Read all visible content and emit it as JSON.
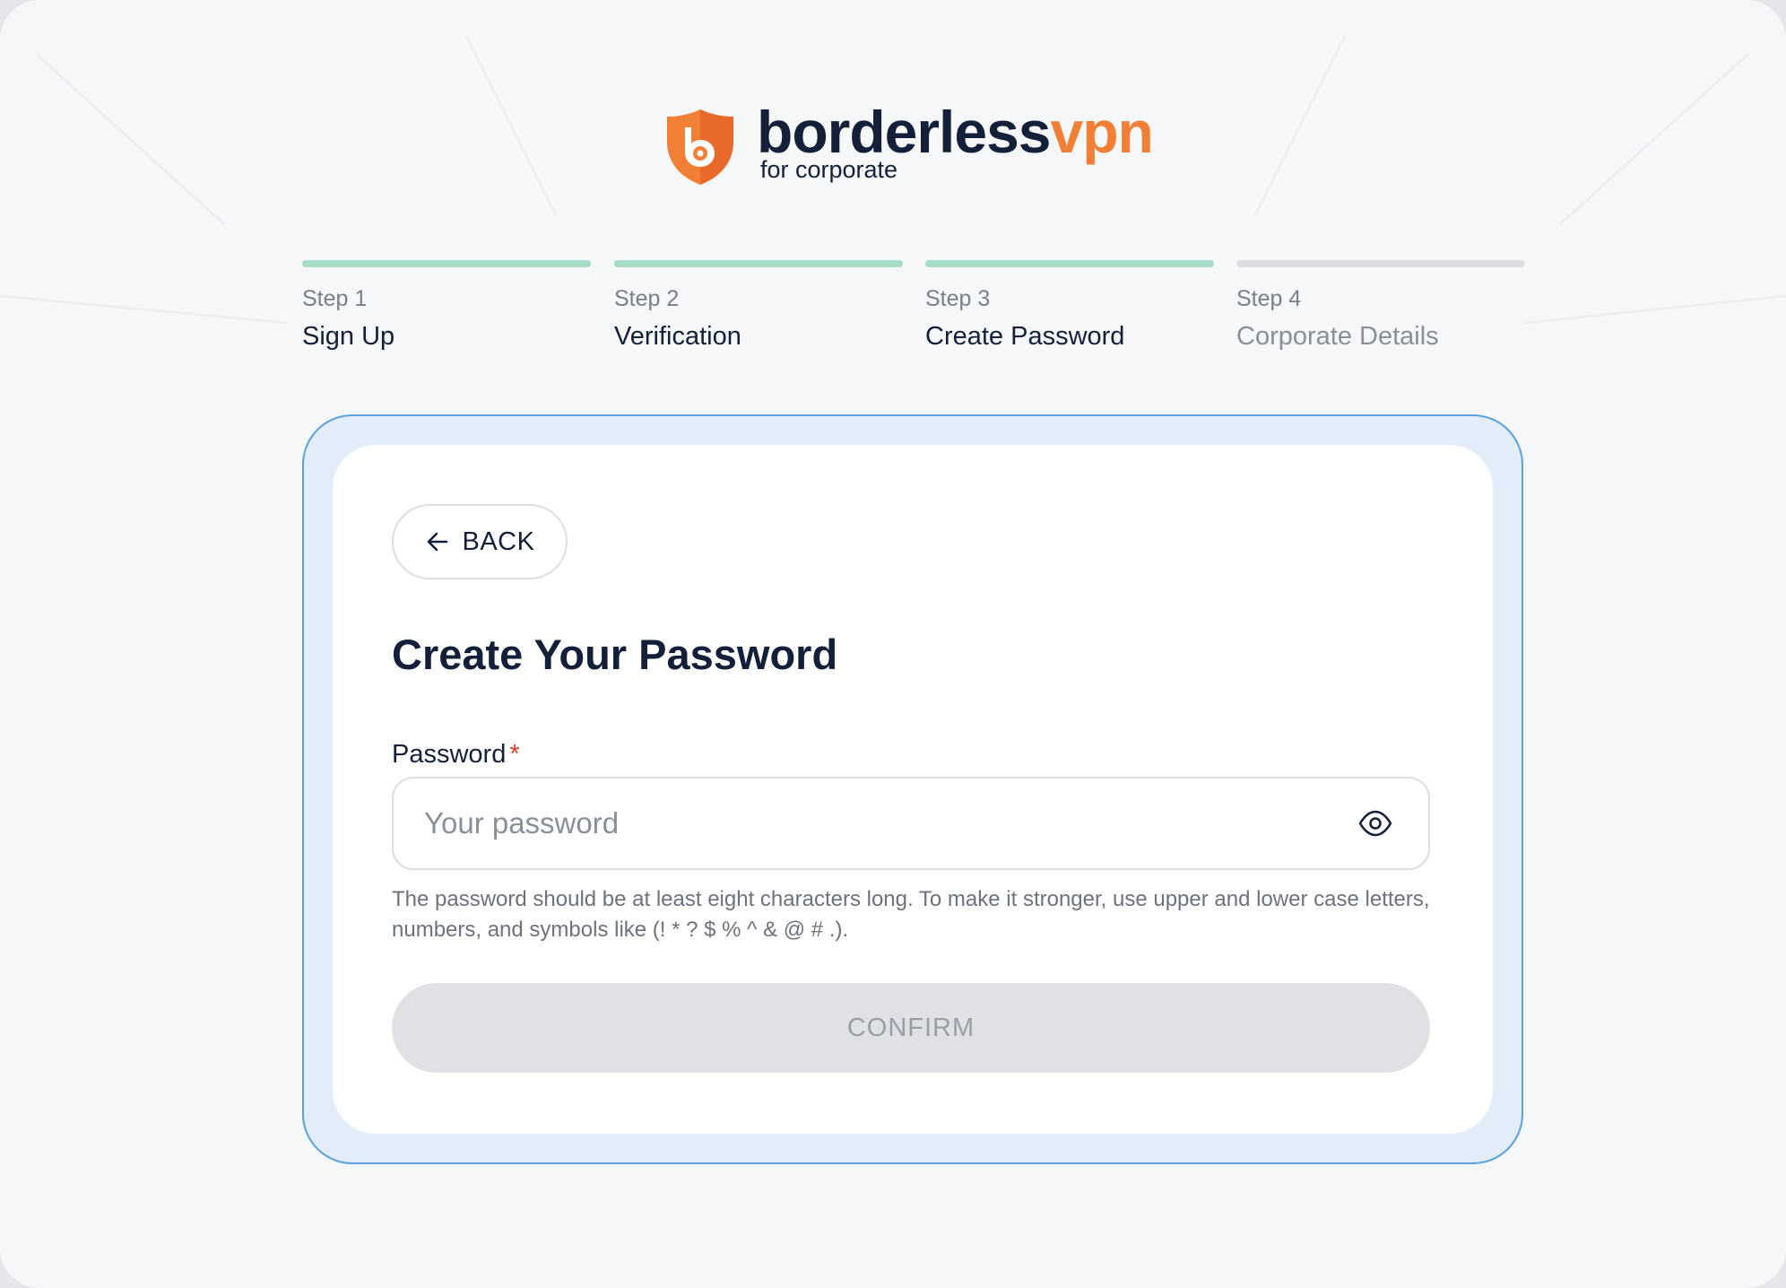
{
  "brand": {
    "name_main": "borderless",
    "name_accent": "vpn",
    "tagline": "for corporate",
    "accent_color": "#f27f36",
    "main_color": "#14203a"
  },
  "steps": [
    {
      "number": "Step 1",
      "title": "Sign Up",
      "status": "complete"
    },
    {
      "number": "Step 2",
      "title": "Verification",
      "status": "complete"
    },
    {
      "number": "Step 3",
      "title": "Create Password",
      "status": "complete"
    },
    {
      "number": "Step 4",
      "title": "Corporate Details",
      "status": "pending"
    }
  ],
  "colors": {
    "step_complete": "#a6dcc6",
    "step_pending": "#dcdee2",
    "card_border": "#5aa1e0",
    "required_mark": "#e03a2b"
  },
  "form": {
    "back_label": "BACK",
    "heading": "Create Your Password",
    "password_label": "Password",
    "required_mark": "*",
    "password_value": "",
    "password_placeholder": "Your password",
    "hint": "The password should be at least eight characters long. To make it stronger, use upper and lower case letters, numbers, and symbols like (! * ? $ % ^ & @ # .).",
    "confirm_label": "CONFIRM",
    "confirm_enabled": false
  },
  "icons": {
    "logo": "shield-logo-icon",
    "back": "arrow-left-icon",
    "toggle_visibility": "eye-icon"
  }
}
